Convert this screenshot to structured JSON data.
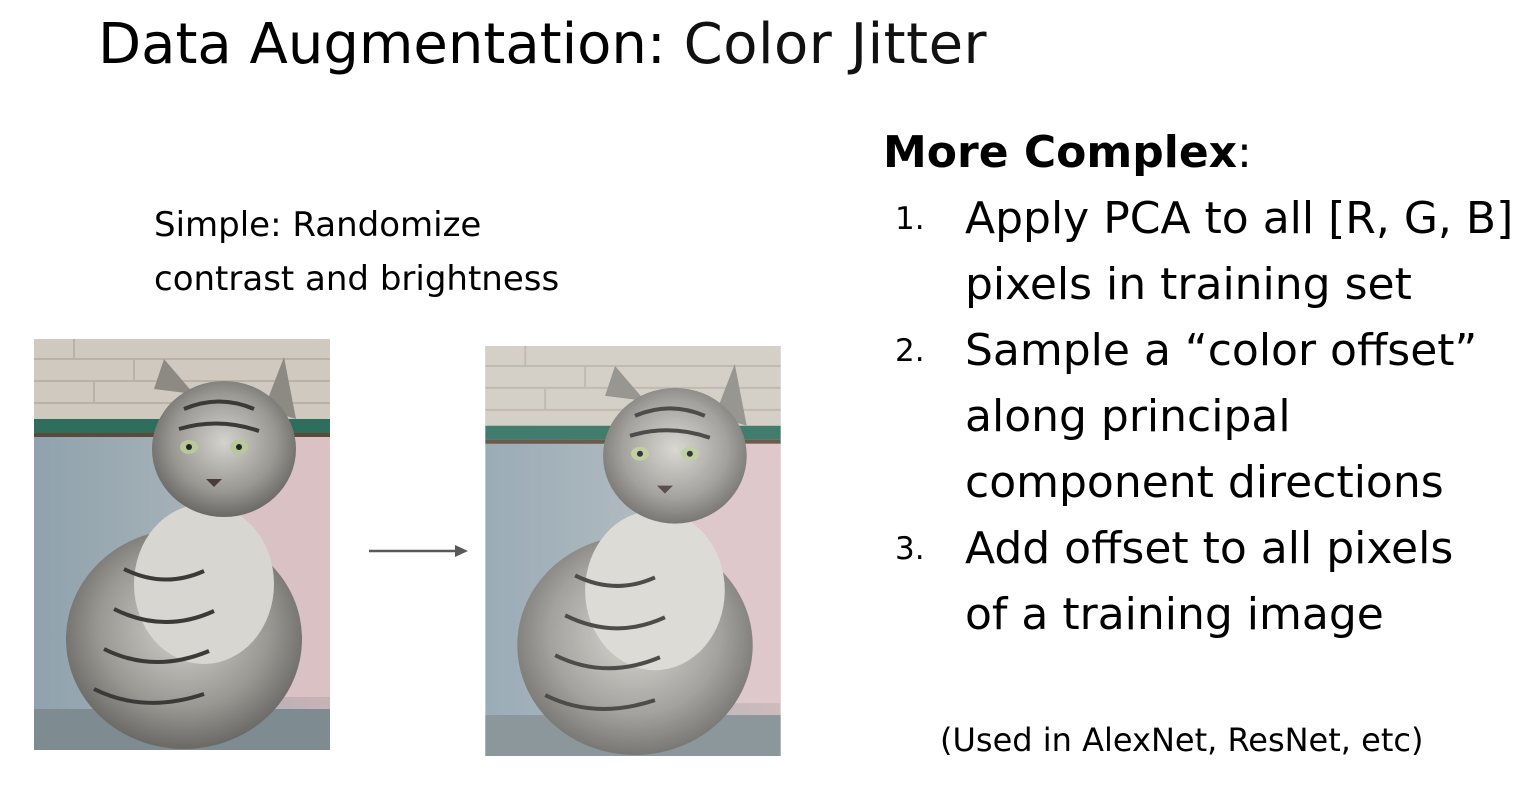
{
  "slide": {
    "title_bold": "Data Augmentation",
    "title_sep": ":",
    "title_light": "Color Jitter",
    "simple_line1": "Simple: Randomize",
    "simple_line2": "contrast and brightness",
    "complex_heading": "More Complex",
    "complex_colon": ":",
    "steps": [
      {
        "num": "1.",
        "lines": [
          "Apply PCA to all [R, G, B]",
          "pixels in training set"
        ]
      },
      {
        "num": "2.",
        "lines": [
          "Sample a “color offset”",
          "along principal",
          "component directions"
        ]
      },
      {
        "num": "3.",
        "lines": [
          "Add offset to all pixels",
          "of a training image"
        ]
      }
    ],
    "note": "(Used in AlexNet, ResNet, etc)"
  }
}
